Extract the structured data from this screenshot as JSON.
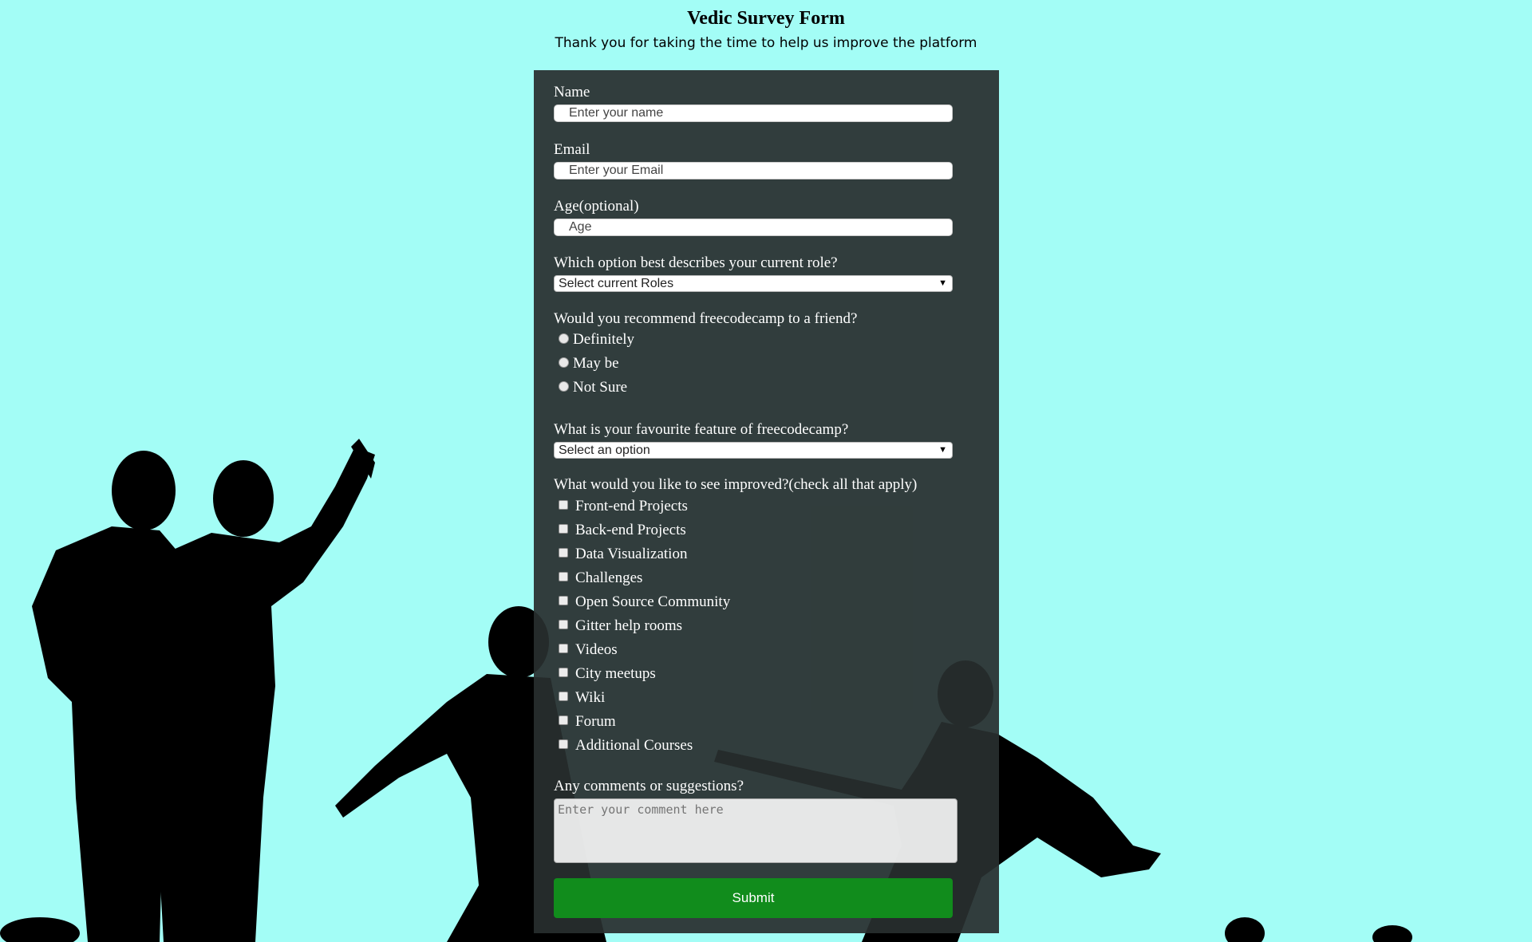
{
  "header": {
    "title": "Vedic Survey Form",
    "subtitle": "Thank you for taking the time to help us improve the platform"
  },
  "form": {
    "name": {
      "label": "Name",
      "placeholder": "Enter your name"
    },
    "email": {
      "label": "Email",
      "placeholder": "Enter your Email"
    },
    "age": {
      "label": "Age(optional)",
      "placeholder": "Age"
    },
    "role": {
      "label": "Which option best describes your current role?",
      "selected": "Select current Roles"
    },
    "recommend": {
      "label": "Would you recommend freecodecamp to a friend?",
      "options": [
        "Definitely",
        "May be",
        "Not Sure"
      ]
    },
    "feature": {
      "label": "What is your favourite feature of freecodecamp?",
      "selected": "Select an option"
    },
    "improve": {
      "label": "What would you like to see improved?(check all that apply)",
      "options": [
        "Front-end Projects",
        "Back-end Projects",
        "Data Visualization",
        "Challenges",
        "Open Source Community",
        "Gitter help rooms",
        "Videos",
        "City meetups",
        "Wiki",
        "Forum",
        "Additional Courses"
      ]
    },
    "comments": {
      "label": "Any comments or suggestions?",
      "placeholder": "Enter your comment here"
    },
    "submit_label": "Submit"
  },
  "colors": {
    "background": "#a3fdf6",
    "panel": "#282e2e",
    "submit": "#118c1c"
  }
}
